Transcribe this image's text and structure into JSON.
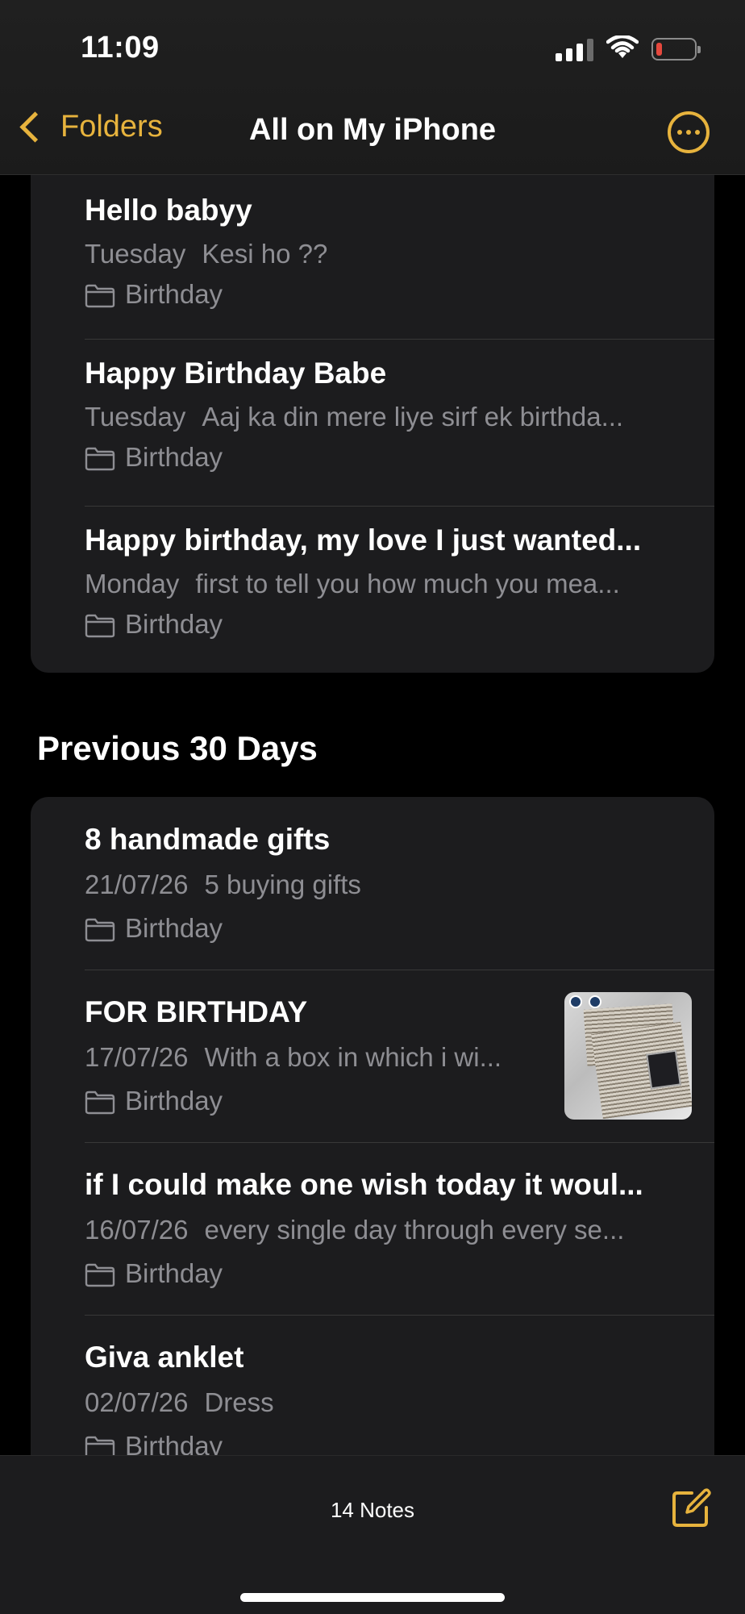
{
  "status_bar": {
    "time": "11:09"
  },
  "nav": {
    "back_label": "Folders",
    "title": "All on My iPhone"
  },
  "sections": {
    "previous_7_days": {
      "notes": [
        {
          "title": "Hello babyy",
          "date": "Tuesday",
          "preview": "Kesi ho ??",
          "folder": "Birthday"
        },
        {
          "title": "Happy Birthday Babe",
          "date": "Tuesday",
          "preview": "Aaj ka din mere liye sirf ek birthda...",
          "folder": "Birthday"
        },
        {
          "title": "Happy birthday, my love I just wanted...",
          "date": "Monday",
          "preview": "first to tell you how much you mea...",
          "folder": "Birthday"
        }
      ]
    },
    "previous_30_days": {
      "header": "Previous 30 Days",
      "notes": [
        {
          "title": "8 handmade gifts",
          "date": "21/07/26",
          "preview": "5 buying gifts",
          "folder": "Birthday"
        },
        {
          "title": "FOR BIRTHDAY",
          "date": "17/07/26",
          "preview": "With a box in which i wi...",
          "folder": "Birthday",
          "has_thumbnail": true
        },
        {
          "title": "if I could make one wish today it woul...",
          "date": "16/07/26",
          "preview": "every single day through every se...",
          "folder": "Birthday"
        },
        {
          "title": "Giva anklet",
          "date": "02/07/26",
          "preview": "Dress",
          "folder": "Birthday"
        }
      ]
    }
  },
  "toolbar": {
    "count_label": "14 Notes"
  },
  "colors": {
    "accent": "#e7b33d",
    "background": "#000000",
    "card": "#1c1c1e",
    "secondary_text": "#8e8e93"
  }
}
